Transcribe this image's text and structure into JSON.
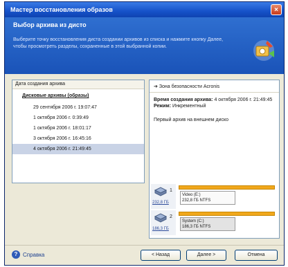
{
  "window": {
    "title": "Мастер восстановления образов",
    "close_glyph": "×"
  },
  "header": {
    "title": "Выбор архива из дисто",
    "description": "Выберите точку восстановления диста создании архивов из списка и нажмите кнопку Далее, чтобы просмотреть разделы, сохраненные в этой выбранной копии."
  },
  "left_panel": {
    "column_header": "Дата создания архива",
    "group_title": "Дисковые архивы (образы)",
    "archives": [
      "29 сентября 2006 г. 19:07:47",
      "1 октября 2006 г. 0:39:49",
      "1 октября 2006 г. 18:01:17",
      "3 октября 2006 г. 16:45:16",
      "4 октября 2006 г. 21:49:45"
    ],
    "selected_index": 4
  },
  "right_panel": {
    "zone_title": "Зона безопасности Acronis",
    "created_label": "Время создания архива:",
    "created_value": "4 октября 2006 г. 21:49:45",
    "mode_label": "Режим:",
    "mode_value": "Инкрементный",
    "note": "Первый архив на внешнем диско",
    "disks": [
      {
        "number": "1",
        "size": "232,8 ГБ",
        "partition_name": "Video (E:)",
        "partition_size": "232,8 ГБ NTFS",
        "selected": false
      },
      {
        "number": "2",
        "size": "186,3 ГБ",
        "partition_name": "System (C:)",
        "partition_size": "186,3 ГБ NTFS",
        "selected": true
      }
    ]
  },
  "footer": {
    "help_label": "Справка",
    "back_label": "< Назад",
    "next_label": "Далее >",
    "cancel_label": "Отмена"
  }
}
